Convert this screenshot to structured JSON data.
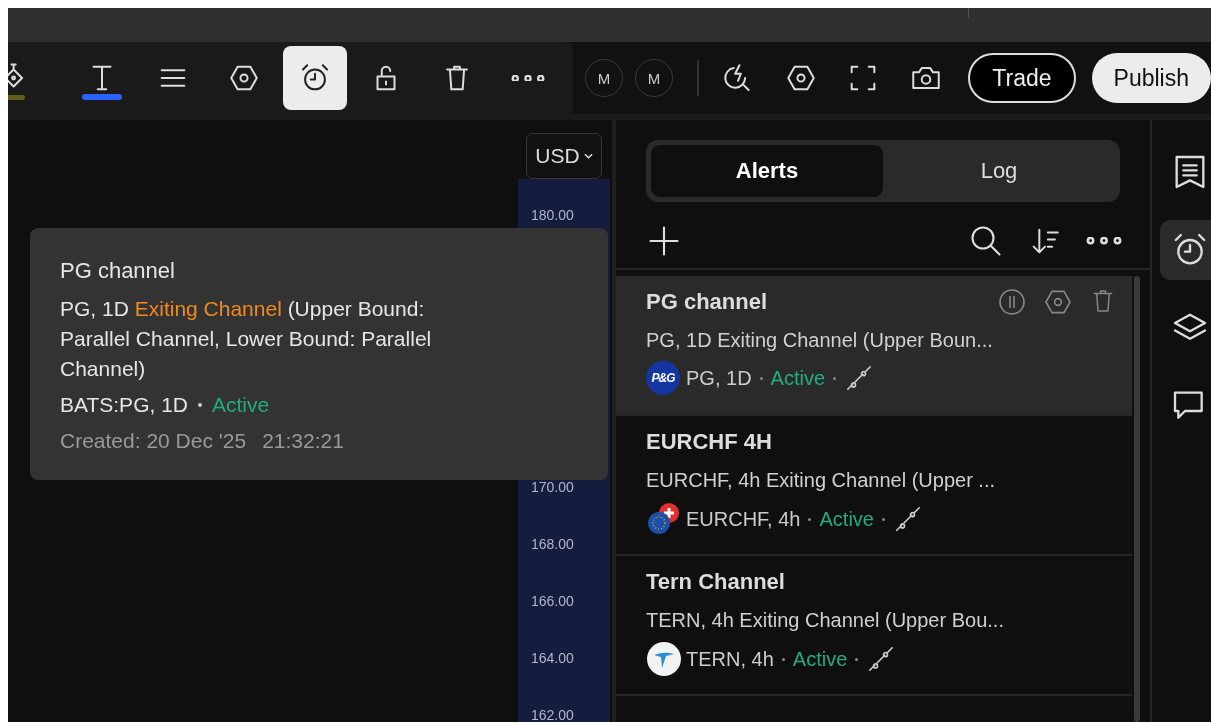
{
  "toolbar": {
    "drawing_tools": [
      {
        "kind": "bucket",
        "selected": false,
        "color": "#5f5f1c"
      },
      {
        "kind": "text",
        "selected": false,
        "color": "#2962ff"
      },
      {
        "kind": "lines",
        "selected": false
      },
      {
        "kind": "settings",
        "selected": false
      },
      {
        "kind": "alarm",
        "selected": true
      },
      {
        "kind": "unlock",
        "selected": false
      },
      {
        "kind": "trash",
        "selected": false
      },
      {
        "kind": "more",
        "selected": false
      }
    ],
    "mark_buttons": [
      "M",
      "M"
    ],
    "actions": [
      {
        "kind": "bolt-search"
      },
      {
        "kind": "settings"
      },
      {
        "kind": "fullscreen"
      },
      {
        "kind": "camera"
      }
    ],
    "buttons": [
      {
        "label": "Trade",
        "kind": "outline"
      },
      {
        "label": "Publish",
        "kind": "filled"
      }
    ]
  },
  "chart": {
    "currency": "USD",
    "price_labels": [
      "180.00",
      "170.00",
      "168.00",
      "166.00",
      "164.00",
      "162.00"
    ]
  },
  "tooltip": {
    "title": "PG channel",
    "description": [
      {
        "text": "PG, 1D ",
        "highlight": false
      },
      {
        "text": "Exiting Channel",
        "highlight": true
      },
      {
        "text": " (Upper Bound: Parallel Channel, Lower Bound: Parallel Channel)",
        "highlight": false
      }
    ],
    "symbol": "BATS:PG, 1D",
    "status": "Active",
    "created": "Created: 20 Dec '25",
    "time": "21:32:21"
  },
  "alerts_panel": {
    "tabs": [
      {
        "label": "Alerts",
        "selected": true
      },
      {
        "label": "Log",
        "selected": false
      }
    ],
    "alerts": [
      {
        "title": "PG channel",
        "description": "PG, 1D Exiting Channel (Upper Boun...",
        "logo": {
          "kind": "monogram",
          "text": "P&G"
        },
        "symbol": "PG, 1D",
        "status": "Active",
        "hovered": true
      },
      {
        "title": "EURCHF 4H",
        "description": "EURCHF, 4h Exiting Channel (Upper ...",
        "logo": {
          "kind": "flags"
        },
        "symbol": "EURCHF, 4h",
        "status": "Active",
        "hovered": false
      },
      {
        "title": "Tern Channel",
        "description": "TERN, 4h Exiting Channel (Upper Bou...",
        "logo": {
          "kind": "bird"
        },
        "symbol": "TERN, 4h",
        "status": "Active",
        "hovered": false
      }
    ]
  },
  "sidebar": [
    {
      "kind": "notes",
      "selected": false
    },
    {
      "kind": "alarm",
      "selected": true
    },
    {
      "kind": "layers",
      "selected": false
    },
    {
      "kind": "chat",
      "selected": false
    }
  ]
}
